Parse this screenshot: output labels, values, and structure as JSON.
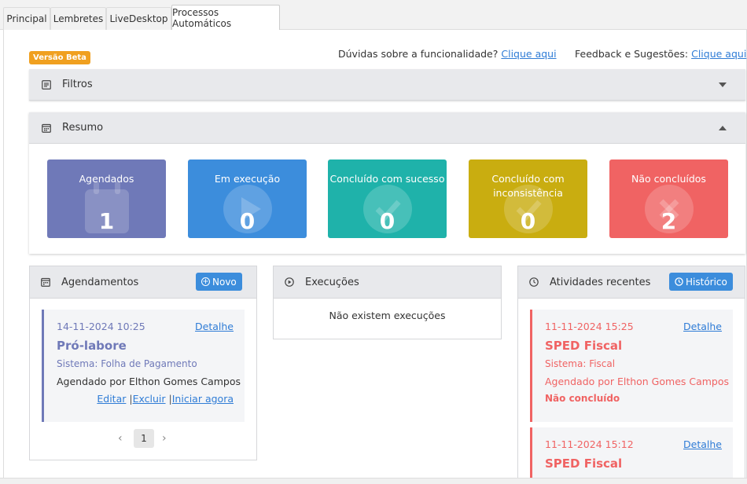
{
  "tabs": [
    "Principal",
    "Lembretes",
    "LiveDesktop",
    "Processos Automáticos"
  ],
  "active_tab": "Processos Automáticos",
  "beta_badge": "Versão Beta",
  "help": {
    "text": "Dúvidas sobre a funcionalidade?",
    "link": "Clique aqui"
  },
  "feedback": {
    "text": "Feedback e Sugestões:",
    "link": "Clique aqui"
  },
  "filters_panel": {
    "title": "Filtros"
  },
  "summary_panel": {
    "title": "Resumo",
    "cards": [
      {
        "title": "Agendados",
        "count": "1",
        "color": "#6f79b8",
        "icon": "calendar-icon"
      },
      {
        "title": "Em execução",
        "count": "0",
        "color": "#3c8ddc",
        "icon": "play-icon"
      },
      {
        "title": "Concluído com sucesso",
        "count": "0",
        "color": "#1fb2aa",
        "icon": "check-icon"
      },
      {
        "title": "Concluído com inconsistência",
        "count": "0",
        "color": "#c9ad10",
        "icon": "check-icon"
      },
      {
        "title": "Não concluídos",
        "count": "2",
        "color": "#f06363",
        "icon": "x-icon"
      }
    ]
  },
  "schedules": {
    "title": "Agendamentos",
    "new_button": "Novo",
    "items": [
      {
        "datetime": "14-11-2024 10:25",
        "detail_link": "Detalhe",
        "name": "Pró-labore",
        "system": "Sistema: Folha de Pagamento",
        "scheduled_by": "Agendado por Elthon Gomes Campos",
        "actions": [
          "Editar",
          "Excluir",
          "Iniciar agora"
        ]
      }
    ],
    "pagination": {
      "current_page": "1"
    }
  },
  "executions": {
    "title": "Execuções",
    "empty_text": "Não existem execuções"
  },
  "recent": {
    "title": "Atividades recentes",
    "history_button": "Histórico",
    "items": [
      {
        "datetime": "11-11-2024 15:25",
        "detail_link": "Detalhe",
        "name": "SPED Fiscal",
        "system": "Sistema: Fiscal",
        "scheduled_by": "Agendado por Elthon Gomes Campos",
        "status": "Não concluído"
      },
      {
        "datetime": "11-11-2024 15:12",
        "detail_link": "Detalhe",
        "name": "SPED Fiscal"
      }
    ]
  },
  "colors": {
    "primary": "#3c8ddc",
    "scheduled": "#6f79b8",
    "error": "#f06363",
    "beta": "#f0a020"
  }
}
